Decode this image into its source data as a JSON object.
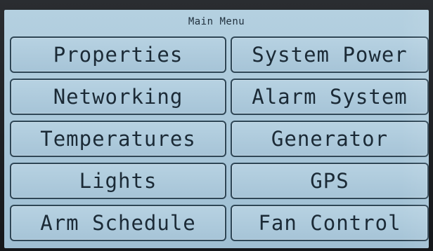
{
  "screen": {
    "title": "Main Menu"
  },
  "menu": {
    "items": [
      {
        "label": "Properties"
      },
      {
        "label": "System Power"
      },
      {
        "label": "Networking"
      },
      {
        "label": "Alarm System"
      },
      {
        "label": "Temperatures"
      },
      {
        "label": "Generator"
      },
      {
        "label": "Lights"
      },
      {
        "label": "GPS"
      },
      {
        "label": "Arm Schedule"
      },
      {
        "label": "Fan Control"
      }
    ]
  },
  "colors": {
    "screen_background": "#a9c7d9",
    "button_border": "#2e4656",
    "text": "#1b2a36"
  }
}
